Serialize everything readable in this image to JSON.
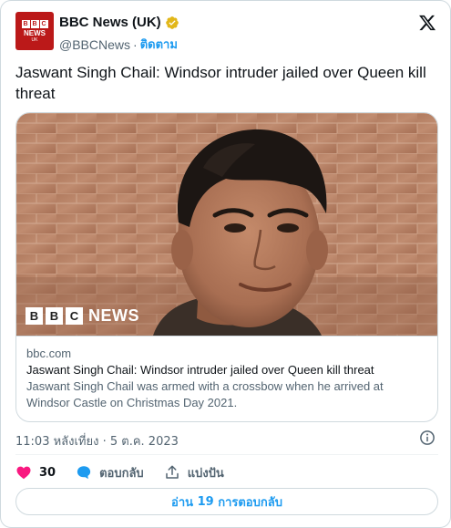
{
  "author": {
    "display_name": "BBC News (UK)",
    "handle": "@BBCNews",
    "separator": "·",
    "follow_label": "ติดตาม",
    "avatar": {
      "blocks": [
        "B",
        "B",
        "C"
      ],
      "word": "NEWS",
      "sub": "UK"
    },
    "verified_color": "#e2b719"
  },
  "tweet": {
    "text": "Jaswant Singh Chail: Windsor intruder jailed over Queen kill threat"
  },
  "link_card": {
    "watermark": {
      "blocks": [
        "B",
        "B",
        "C"
      ],
      "word": "NEWS"
    },
    "domain": "bbc.com",
    "title": "Jaswant Singh Chail: Windsor intruder jailed over Queen kill threat",
    "description": "Jaswant Singh Chail was armed with a crossbow when he arrived at Windsor Castle on Christmas Day 2021."
  },
  "meta": {
    "timestamp": "11:03 หลังเที่ยง · 5 ต.ค. 2023"
  },
  "actions": {
    "like_count": "30",
    "reply_label": "ตอบกลับ",
    "share_label": "แบ่งปัน"
  },
  "read_replies": {
    "prefix": "อ่าน",
    "count": "19",
    "suffix": "การตอบกลับ"
  },
  "colors": {
    "accent": "#1d9bf0",
    "like": "#f91880",
    "bbc_red": "#bb1919",
    "border": "#cfd9de",
    "muted": "#536471"
  },
  "icons": {
    "logo": "x-logo-icon",
    "verified": "verified-badge-icon",
    "info": "info-icon",
    "like": "heart-icon",
    "reply": "speech-bubble-icon",
    "share": "share-upload-icon"
  }
}
